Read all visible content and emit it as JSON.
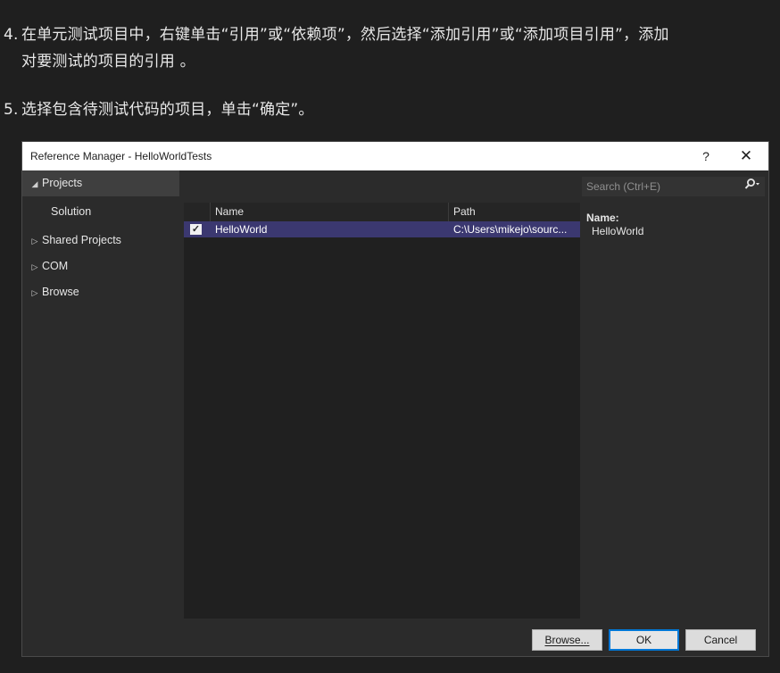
{
  "steps": [
    {
      "number": "4.",
      "line1": "在单元测试项目中，右键单击“引用”或“依赖项”，然后选择“添加引用”或“添加项目引用”，添加",
      "line2": "对要测试的项目的引用 。"
    },
    {
      "number": "5.",
      "line1": "选择包含待测试代码的项目，单击“确定”。"
    }
  ],
  "dialog": {
    "title": "Reference Manager - HelloWorldTests",
    "help_label": "?",
    "close_label": "✕",
    "nav": [
      {
        "label": "Projects",
        "expander": "◢",
        "selected": true
      },
      {
        "label": "Solution"
      },
      {
        "label": "Shared Projects",
        "expander": "▷"
      },
      {
        "label": "COM",
        "expander": "▷"
      },
      {
        "label": "Browse",
        "expander": "▷"
      }
    ],
    "search": {
      "placeholder": "Search (Ctrl+E)",
      "icon": "search-icon"
    },
    "columns": [
      "Name",
      "Path"
    ],
    "rows": [
      {
        "checked": true,
        "name": "HelloWorld",
        "path": "C:\\Users\\mikejo\\sourc..."
      }
    ],
    "details": {
      "label": "Name:",
      "value": "HelloWorld"
    },
    "buttons": {
      "browse": "Browse...",
      "ok": "OK",
      "cancel": "Cancel"
    }
  },
  "colors": {
    "selection": "#3b3870",
    "accent": "#0078d7"
  }
}
